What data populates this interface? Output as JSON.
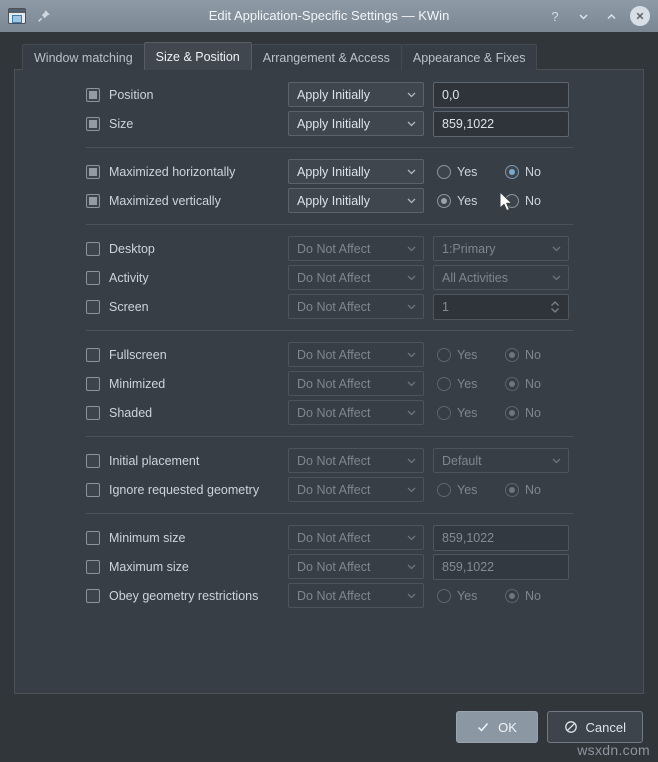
{
  "window": {
    "title": "Edit Application-Specific Settings — KWin",
    "app_icon": "window-settings-icon",
    "pin_icon": "pin-icon",
    "help_label": "?",
    "minimize_icon": "chevron-down-icon",
    "maximize_icon": "chevron-up-icon",
    "close_icon": "close-icon"
  },
  "tabs": [
    {
      "label": "Window matching",
      "active": false
    },
    {
      "label": "Size & Position",
      "active": true
    },
    {
      "label": "Arrangement & Access",
      "active": false
    },
    {
      "label": "Appearance & Fixes",
      "active": false
    }
  ],
  "rows": [
    {
      "label": "Position",
      "rule": "Apply Initially",
      "value": "0,0"
    },
    {
      "label": "Size",
      "rule": "Apply Initially",
      "value": "859,1022"
    },
    {
      "label": "Maximized horizontally",
      "rule": "Apply Initially",
      "yes": "Yes",
      "no": "No"
    },
    {
      "label": "Maximized vertically",
      "rule": "Apply Initially",
      "yes": "Yes",
      "no": "No"
    },
    {
      "label": "Desktop",
      "rule": "Do Not Affect",
      "value": "1:Primary"
    },
    {
      "label": "Activity",
      "rule": "Do Not Affect",
      "value": "All Activities"
    },
    {
      "label": "Screen",
      "rule": "Do Not Affect",
      "value": "1"
    },
    {
      "label": "Fullscreen",
      "rule": "Do Not Affect",
      "yes": "Yes",
      "no": "No"
    },
    {
      "label": "Minimized",
      "rule": "Do Not Affect",
      "yes": "Yes",
      "no": "No"
    },
    {
      "label": "Shaded",
      "rule": "Do Not Affect",
      "yes": "Yes",
      "no": "No"
    },
    {
      "label": "Initial placement",
      "rule": "Do Not Affect",
      "value": "Default"
    },
    {
      "label": "Ignore requested geometry",
      "rule": "Do Not Affect",
      "yes": "Yes",
      "no": "No"
    },
    {
      "label": "Minimum size",
      "rule": "Do Not Affect",
      "value": "859,1022"
    },
    {
      "label": "Maximum size",
      "rule": "Do Not Affect",
      "value": "859,1022"
    },
    {
      "label": "Obey geometry restrictions",
      "rule": "Do Not Affect",
      "yes": "Yes",
      "no": "No"
    }
  ],
  "buttons": {
    "ok": "OK",
    "cancel": "Cancel",
    "ok_icon": "check-icon",
    "cancel_icon": "cancel-icon"
  },
  "watermark": "wsxdn.com",
  "colors": {
    "titlebar": "#8e9aa6",
    "panel": "#383e45",
    "background": "#31363b",
    "accent": "#7aa8d0"
  }
}
